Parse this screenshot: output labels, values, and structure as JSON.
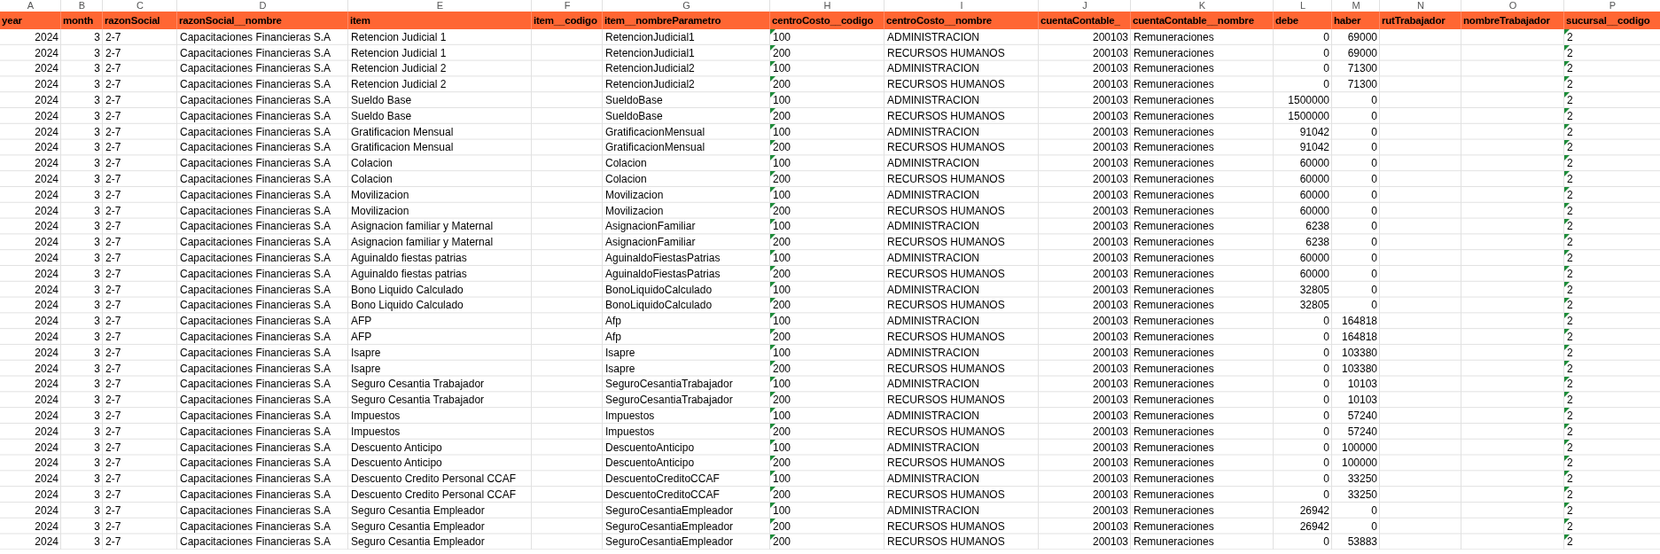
{
  "columns": [
    {
      "letter": "A",
      "header": "year",
      "kind": "number"
    },
    {
      "letter": "B",
      "header": "month",
      "kind": "number"
    },
    {
      "letter": "C",
      "header": "razonSocial",
      "kind": "text"
    },
    {
      "letter": "D",
      "header": "razonSocial__nombre",
      "kind": "text"
    },
    {
      "letter": "E",
      "header": "item",
      "kind": "text"
    },
    {
      "letter": "F",
      "header": "item__codigo",
      "kind": "text"
    },
    {
      "letter": "G",
      "header": "item__nombreParametro",
      "kind": "text"
    },
    {
      "letter": "H",
      "header": "centroCosto__codigo",
      "kind": "text_number"
    },
    {
      "letter": "I",
      "header": "centroCosto__nombre",
      "kind": "text"
    },
    {
      "letter": "J",
      "header": "cuentaContable_",
      "kind": "number"
    },
    {
      "letter": "K",
      "header": "cuentaContable__nombre",
      "kind": "text"
    },
    {
      "letter": "L",
      "header": "debe",
      "kind": "number"
    },
    {
      "letter": "M",
      "header": "haber",
      "kind": "number"
    },
    {
      "letter": "N",
      "header": "rutTrabajador",
      "kind": "text"
    },
    {
      "letter": "O",
      "header": "nombreTrabajador",
      "kind": "text"
    },
    {
      "letter": "P",
      "header": "sucursal__codigo",
      "kind": "text_number"
    }
  ],
  "rows": [
    {
      "A": "2024",
      "B": "3",
      "C": "2-7",
      "D": "Capacitaciones Financieras S.A",
      "E": "Retencion Judicial 1",
      "G": "RetencionJudicial1",
      "H": "100",
      "I": "ADMINISTRACION",
      "J": "200103",
      "K": "Remuneraciones",
      "L": "0",
      "M": "69000",
      "P": "2"
    },
    {
      "A": "2024",
      "B": "3",
      "C": "2-7",
      "D": "Capacitaciones Financieras S.A",
      "E": "Retencion Judicial 1",
      "G": "RetencionJudicial1",
      "H": "200",
      "I": "RECURSOS HUMANOS",
      "J": "200103",
      "K": "Remuneraciones",
      "L": "0",
      "M": "69000",
      "P": "2"
    },
    {
      "A": "2024",
      "B": "3",
      "C": "2-7",
      "D": "Capacitaciones Financieras S.A",
      "E": "Retencion Judicial 2",
      "G": "RetencionJudicial2",
      "H": "100",
      "I": "ADMINISTRACION",
      "J": "200103",
      "K": "Remuneraciones",
      "L": "0",
      "M": "71300",
      "P": "2"
    },
    {
      "A": "2024",
      "B": "3",
      "C": "2-7",
      "D": "Capacitaciones Financieras S.A",
      "E": "Retencion Judicial 2",
      "G": "RetencionJudicial2",
      "H": "200",
      "I": "RECURSOS HUMANOS",
      "J": "200103",
      "K": "Remuneraciones",
      "L": "0",
      "M": "71300",
      "P": "2"
    },
    {
      "A": "2024",
      "B": "3",
      "C": "2-7",
      "D": "Capacitaciones Financieras S.A",
      "E": "Sueldo Base",
      "G": "SueldoBase",
      "H": "100",
      "I": "ADMINISTRACION",
      "J": "200103",
      "K": "Remuneraciones",
      "L": "1500000",
      "M": "0",
      "P": "2"
    },
    {
      "A": "2024",
      "B": "3",
      "C": "2-7",
      "D": "Capacitaciones Financieras S.A",
      "E": "Sueldo Base",
      "G": "SueldoBase",
      "H": "200",
      "I": "RECURSOS HUMANOS",
      "J": "200103",
      "K": "Remuneraciones",
      "L": "1500000",
      "M": "0",
      "P": "2"
    },
    {
      "A": "2024",
      "B": "3",
      "C": "2-7",
      "D": "Capacitaciones Financieras S.A",
      "E": "Gratificacion Mensual",
      "G": "GratificacionMensual",
      "H": "100",
      "I": "ADMINISTRACION",
      "J": "200103",
      "K": "Remuneraciones",
      "L": "91042",
      "M": "0",
      "P": "2"
    },
    {
      "A": "2024",
      "B": "3",
      "C": "2-7",
      "D": "Capacitaciones Financieras S.A",
      "E": "Gratificacion Mensual",
      "G": "GratificacionMensual",
      "H": "200",
      "I": "RECURSOS HUMANOS",
      "J": "200103",
      "K": "Remuneraciones",
      "L": "91042",
      "M": "0",
      "P": "2"
    },
    {
      "A": "2024",
      "B": "3",
      "C": "2-7",
      "D": "Capacitaciones Financieras S.A",
      "E": "Colacion",
      "G": "Colacion",
      "H": "100",
      "I": "ADMINISTRACION",
      "J": "200103",
      "K": "Remuneraciones",
      "L": "60000",
      "M": "0",
      "P": "2"
    },
    {
      "A": "2024",
      "B": "3",
      "C": "2-7",
      "D": "Capacitaciones Financieras S.A",
      "E": "Colacion",
      "G": "Colacion",
      "H": "200",
      "I": "RECURSOS HUMANOS",
      "J": "200103",
      "K": "Remuneraciones",
      "L": "60000",
      "M": "0",
      "P": "2"
    },
    {
      "A": "2024",
      "B": "3",
      "C": "2-7",
      "D": "Capacitaciones Financieras S.A",
      "E": "Movilizacion",
      "G": "Movilizacion",
      "H": "100",
      "I": "ADMINISTRACION",
      "J": "200103",
      "K": "Remuneraciones",
      "L": "60000",
      "M": "0",
      "P": "2"
    },
    {
      "A": "2024",
      "B": "3",
      "C": "2-7",
      "D": "Capacitaciones Financieras S.A",
      "E": "Movilizacion",
      "G": "Movilizacion",
      "H": "200",
      "I": "RECURSOS HUMANOS",
      "J": "200103",
      "K": "Remuneraciones",
      "L": "60000",
      "M": "0",
      "P": "2"
    },
    {
      "A": "2024",
      "B": "3",
      "C": "2-7",
      "D": "Capacitaciones Financieras S.A",
      "E": "Asignacion familiar y Maternal",
      "G": "AsignacionFamiliar",
      "H": "100",
      "I": "ADMINISTRACION",
      "J": "200103",
      "K": "Remuneraciones",
      "L": "6238",
      "M": "0",
      "P": "2"
    },
    {
      "A": "2024",
      "B": "3",
      "C": "2-7",
      "D": "Capacitaciones Financieras S.A",
      "E": "Asignacion familiar y Maternal",
      "G": "AsignacionFamiliar",
      "H": "200",
      "I": "RECURSOS HUMANOS",
      "J": "200103",
      "K": "Remuneraciones",
      "L": "6238",
      "M": "0",
      "P": "2"
    },
    {
      "A": "2024",
      "B": "3",
      "C": "2-7",
      "D": "Capacitaciones Financieras S.A",
      "E": "Aguinaldo fiestas patrias",
      "G": "AguinaldoFiestasPatrias",
      "H": "100",
      "I": "ADMINISTRACION",
      "J": "200103",
      "K": "Remuneraciones",
      "L": "60000",
      "M": "0",
      "P": "2"
    },
    {
      "A": "2024",
      "B": "3",
      "C": "2-7",
      "D": "Capacitaciones Financieras S.A",
      "E": "Aguinaldo fiestas patrias",
      "G": "AguinaldoFiestasPatrias",
      "H": "200",
      "I": "RECURSOS HUMANOS",
      "J": "200103",
      "K": "Remuneraciones",
      "L": "60000",
      "M": "0",
      "P": "2"
    },
    {
      "A": "2024",
      "B": "3",
      "C": "2-7",
      "D": "Capacitaciones Financieras S.A",
      "E": "Bono Liquido Calculado",
      "G": "BonoLiquidoCalculado",
      "H": "100",
      "I": "ADMINISTRACION",
      "J": "200103",
      "K": "Remuneraciones",
      "L": "32805",
      "M": "0",
      "P": "2"
    },
    {
      "A": "2024",
      "B": "3",
      "C": "2-7",
      "D": "Capacitaciones Financieras S.A",
      "E": "Bono Liquido Calculado",
      "G": "BonoLiquidoCalculado",
      "H": "200",
      "I": "RECURSOS HUMANOS",
      "J": "200103",
      "K": "Remuneraciones",
      "L": "32805",
      "M": "0",
      "P": "2"
    },
    {
      "A": "2024",
      "B": "3",
      "C": "2-7",
      "D": "Capacitaciones Financieras S.A",
      "E": "AFP",
      "G": "Afp",
      "H": "100",
      "I": "ADMINISTRACION",
      "J": "200103",
      "K": "Remuneraciones",
      "L": "0",
      "M": "164818",
      "P": "2"
    },
    {
      "A": "2024",
      "B": "3",
      "C": "2-7",
      "D": "Capacitaciones Financieras S.A",
      "E": "AFP",
      "G": "Afp",
      "H": "200",
      "I": "RECURSOS HUMANOS",
      "J": "200103",
      "K": "Remuneraciones",
      "L": "0",
      "M": "164818",
      "P": "2"
    },
    {
      "A": "2024",
      "B": "3",
      "C": "2-7",
      "D": "Capacitaciones Financieras S.A",
      "E": "Isapre",
      "G": "Isapre",
      "H": "100",
      "I": "ADMINISTRACION",
      "J": "200103",
      "K": "Remuneraciones",
      "L": "0",
      "M": "103380",
      "P": "2"
    },
    {
      "A": "2024",
      "B": "3",
      "C": "2-7",
      "D": "Capacitaciones Financieras S.A",
      "E": "Isapre",
      "G": "Isapre",
      "H": "200",
      "I": "RECURSOS HUMANOS",
      "J": "200103",
      "K": "Remuneraciones",
      "L": "0",
      "M": "103380",
      "P": "2"
    },
    {
      "A": "2024",
      "B": "3",
      "C": "2-7",
      "D": "Capacitaciones Financieras S.A",
      "E": "Seguro Cesantia Trabajador",
      "G": "SeguroCesantiaTrabajador",
      "H": "100",
      "I": "ADMINISTRACION",
      "J": "200103",
      "K": "Remuneraciones",
      "L": "0",
      "M": "10103",
      "P": "2"
    },
    {
      "A": "2024",
      "B": "3",
      "C": "2-7",
      "D": "Capacitaciones Financieras S.A",
      "E": "Seguro Cesantia Trabajador",
      "G": "SeguroCesantiaTrabajador",
      "H": "200",
      "I": "RECURSOS HUMANOS",
      "J": "200103",
      "K": "Remuneraciones",
      "L": "0",
      "M": "10103",
      "P": "2"
    },
    {
      "A": "2024",
      "B": "3",
      "C": "2-7",
      "D": "Capacitaciones Financieras S.A",
      "E": "Impuestos",
      "G": "Impuestos",
      "H": "100",
      "I": "ADMINISTRACION",
      "J": "200103",
      "K": "Remuneraciones",
      "L": "0",
      "M": "57240",
      "P": "2"
    },
    {
      "A": "2024",
      "B": "3",
      "C": "2-7",
      "D": "Capacitaciones Financieras S.A",
      "E": "Impuestos",
      "G": "Impuestos",
      "H": "200",
      "I": "RECURSOS HUMANOS",
      "J": "200103",
      "K": "Remuneraciones",
      "L": "0",
      "M": "57240",
      "P": "2"
    },
    {
      "A": "2024",
      "B": "3",
      "C": "2-7",
      "D": "Capacitaciones Financieras S.A",
      "E": "Descuento Anticipo",
      "G": "DescuentoAnticipo",
      "H": "100",
      "I": "ADMINISTRACION",
      "J": "200103",
      "K": "Remuneraciones",
      "L": "0",
      "M": "100000",
      "P": "2"
    },
    {
      "A": "2024",
      "B": "3",
      "C": "2-7",
      "D": "Capacitaciones Financieras S.A",
      "E": "Descuento Anticipo",
      "G": "DescuentoAnticipo",
      "H": "200",
      "I": "RECURSOS HUMANOS",
      "J": "200103",
      "K": "Remuneraciones",
      "L": "0",
      "M": "100000",
      "P": "2"
    },
    {
      "A": "2024",
      "B": "3",
      "C": "2-7",
      "D": "Capacitaciones Financieras S.A",
      "E": "Descuento Credito Personal CCAF",
      "G": "DescuentoCreditoCCAF",
      "H": "100",
      "I": "ADMINISTRACION",
      "J": "200103",
      "K": "Remuneraciones",
      "L": "0",
      "M": "33250",
      "P": "2"
    },
    {
      "A": "2024",
      "B": "3",
      "C": "2-7",
      "D": "Capacitaciones Financieras S.A",
      "E": "Descuento Credito Personal CCAF",
      "G": "DescuentoCreditoCCAF",
      "H": "200",
      "I": "RECURSOS HUMANOS",
      "J": "200103",
      "K": "Remuneraciones",
      "L": "0",
      "M": "33250",
      "P": "2"
    },
    {
      "A": "2024",
      "B": "3",
      "C": "2-7",
      "D": "Capacitaciones Financieras S.A",
      "E": "Seguro Cesantia Empleador",
      "G": "SeguroCesantiaEmpleador",
      "H": "100",
      "I": "ADMINISTRACION",
      "J": "200103",
      "K": "Remuneraciones",
      "L": "26942",
      "M": "0",
      "P": "2"
    },
    {
      "A": "2024",
      "B": "3",
      "C": "2-7",
      "D": "Capacitaciones Financieras S.A",
      "E": "Seguro Cesantia Empleador",
      "G": "SeguroCesantiaEmpleador",
      "H": "200",
      "I": "RECURSOS HUMANOS",
      "J": "200103",
      "K": "Remuneraciones",
      "L": "26942",
      "M": "0",
      "P": "2"
    },
    {
      "A": "2024",
      "B": "3",
      "C": "2-7",
      "D": "Capacitaciones Financieras S.A",
      "E": "Seguro Cesantia Empleador",
      "G": "SeguroCesantiaEmpleador",
      "H": "200",
      "I": "RECURSOS HUMANOS",
      "J": "200103",
      "K": "Remuneraciones",
      "L": "0",
      "M": "53883",
      "P": "2"
    }
  ]
}
